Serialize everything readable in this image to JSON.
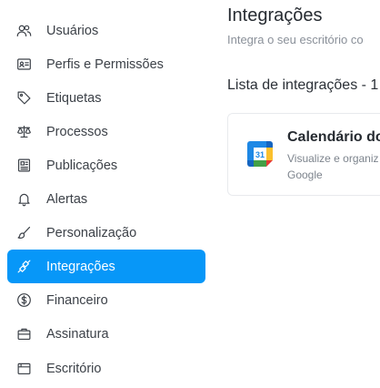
{
  "sidebar": {
    "items": [
      {
        "label": "Usuários",
        "icon": "users-icon"
      },
      {
        "label": "Perfis e Permissões",
        "icon": "id-card-icon"
      },
      {
        "label": "Etiquetas",
        "icon": "tag-icon"
      },
      {
        "label": "Processos",
        "icon": "scale-icon"
      },
      {
        "label": "Publicações",
        "icon": "newspaper-icon"
      },
      {
        "label": "Alertas",
        "icon": "bell-icon"
      },
      {
        "label": "Personalização",
        "icon": "brush-icon"
      },
      {
        "label": "Integrações",
        "icon": "plug-icon",
        "active": true
      },
      {
        "label": "Financeiro",
        "icon": "dollar-circle-icon"
      },
      {
        "label": "Assinatura",
        "icon": "briefcase-icon"
      },
      {
        "label": "Escritório",
        "icon": "folder-icon"
      }
    ]
  },
  "main": {
    "title": "Integrações",
    "subtitle": "Integra o seu escritório co",
    "list_heading": "Lista de integrações - 1",
    "cards": [
      {
        "title": "Calendário do",
        "desc_line1": "Visualize e organiz",
        "desc_line2": "Google",
        "icon_number": "31"
      }
    ]
  },
  "colors": {
    "accent": "#0797f8",
    "text": "#3c4148",
    "muted": "#8a9099"
  }
}
